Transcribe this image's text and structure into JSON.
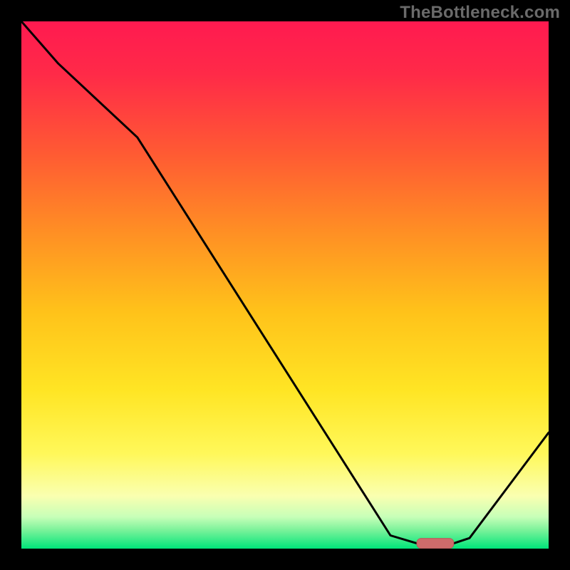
{
  "watermark": {
    "text": "TheBottleneck.com"
  },
  "colors": {
    "background": "#000000",
    "gradient_stops": [
      {
        "offset": 0.0,
        "color": "#ff1a50"
      },
      {
        "offset": 0.1,
        "color": "#ff2a48"
      },
      {
        "offset": 0.25,
        "color": "#ff5a33"
      },
      {
        "offset": 0.4,
        "color": "#ff8f24"
      },
      {
        "offset": 0.55,
        "color": "#ffc21a"
      },
      {
        "offset": 0.7,
        "color": "#ffe524"
      },
      {
        "offset": 0.82,
        "color": "#fff85a"
      },
      {
        "offset": 0.9,
        "color": "#faffb0"
      },
      {
        "offset": 0.94,
        "color": "#c7ffb8"
      },
      {
        "offset": 0.965,
        "color": "#7af29a"
      },
      {
        "offset": 1.0,
        "color": "#00e57a"
      }
    ],
    "curve": "#000000",
    "marker_fill": "#cf6b6b",
    "marker_stroke": "#b85a5a"
  },
  "chart_data": {
    "type": "line",
    "title": "",
    "xlabel": "",
    "ylabel": "",
    "xlim": [
      0,
      100
    ],
    "ylim": [
      0,
      100
    ],
    "x": [
      0,
      7,
      22,
      70,
      75,
      82,
      85,
      100
    ],
    "values": [
      100,
      92,
      78,
      2.5,
      1,
      1,
      2,
      22
    ],
    "flat_segment": {
      "x_start": 75,
      "x_end": 82,
      "y": 1
    },
    "annotations": [
      {
        "kind": "marker-bar",
        "x_start": 75,
        "x_end": 82,
        "y": 1
      }
    ]
  }
}
